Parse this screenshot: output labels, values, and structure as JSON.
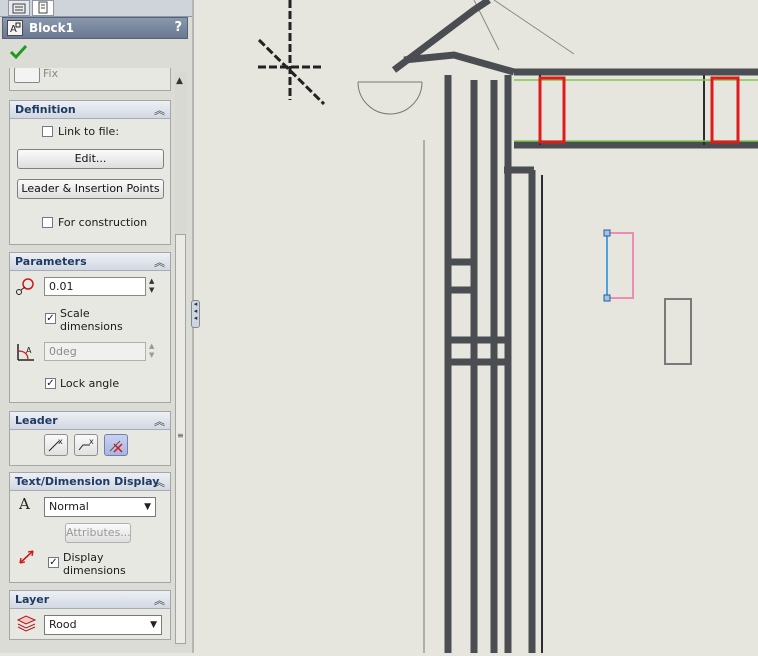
{
  "panel": {
    "title": "Block1",
    "help": "?",
    "partial_top_label": "Fix"
  },
  "definition": {
    "header": "Definition",
    "link_label": "Link to file:",
    "link_checked": false,
    "edit_button": "Edit...",
    "leader_button": "Leader & Insertion Points",
    "construction_label": "For construction",
    "construction_checked": false
  },
  "parameters": {
    "header": "Parameters",
    "scale_value": "0.01",
    "scale_dims_label": "Scale dimensions",
    "scale_dims_checked": true,
    "angle_value": "0deg",
    "lock_angle_label": "Lock angle",
    "lock_angle_checked": true
  },
  "leader": {
    "header": "Leader"
  },
  "text_display": {
    "header": "Text/Dimension Display",
    "font_style": "Normal",
    "attributes_button": "Attributes...",
    "display_dims_label": "Display dimensions",
    "display_dims_checked": true
  },
  "layer": {
    "header": "Layer",
    "value": "Rood"
  },
  "colors": {
    "header_text": "#1f3a63",
    "ok_check": "#1e9c1e",
    "highlight_red": "#e01b1b",
    "sketch_blue": "#4aa3df",
    "sketch_pink": "#f08cb4",
    "green_line": "#7fc84a"
  },
  "icons": [
    "ok-check-icon",
    "scale-icon",
    "angle-icon",
    "leader-icons",
    "font-icon",
    "dimension-display-icon",
    "layer-icon"
  ]
}
